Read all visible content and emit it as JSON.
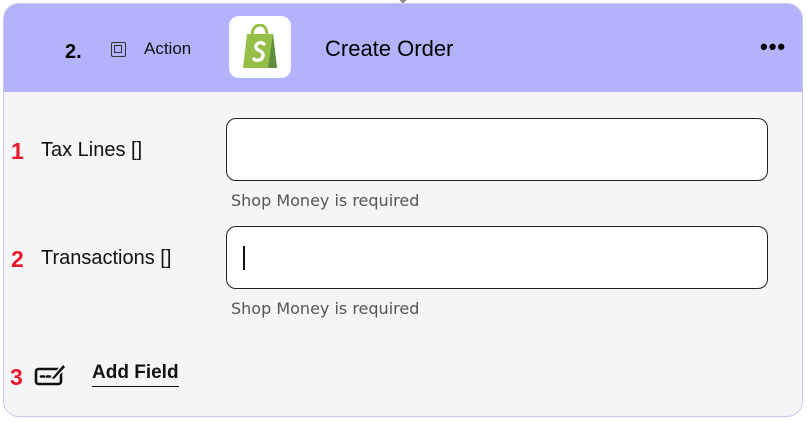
{
  "step": {
    "number": "2.",
    "type_label": "Action",
    "app_icon": "shopify-bag-icon",
    "title": "Create Order",
    "menu_glyph": "•••"
  },
  "fields": [
    {
      "marker": "1",
      "label": "Tax Lines []",
      "value": "",
      "helper": "Shop Money is required",
      "focused": false
    },
    {
      "marker": "2",
      "label": "Transactions []",
      "value": "",
      "helper": "Shop Money is required",
      "focused": true
    }
  ],
  "add_field": {
    "marker": "3",
    "label": "Add Field",
    "icon": "edit-field-icon"
  },
  "colors": {
    "header_bg": "#b3b3fb",
    "card_bg": "#f5f5f8",
    "marker": "#e8192c",
    "shopify_green": "#95bf47"
  }
}
